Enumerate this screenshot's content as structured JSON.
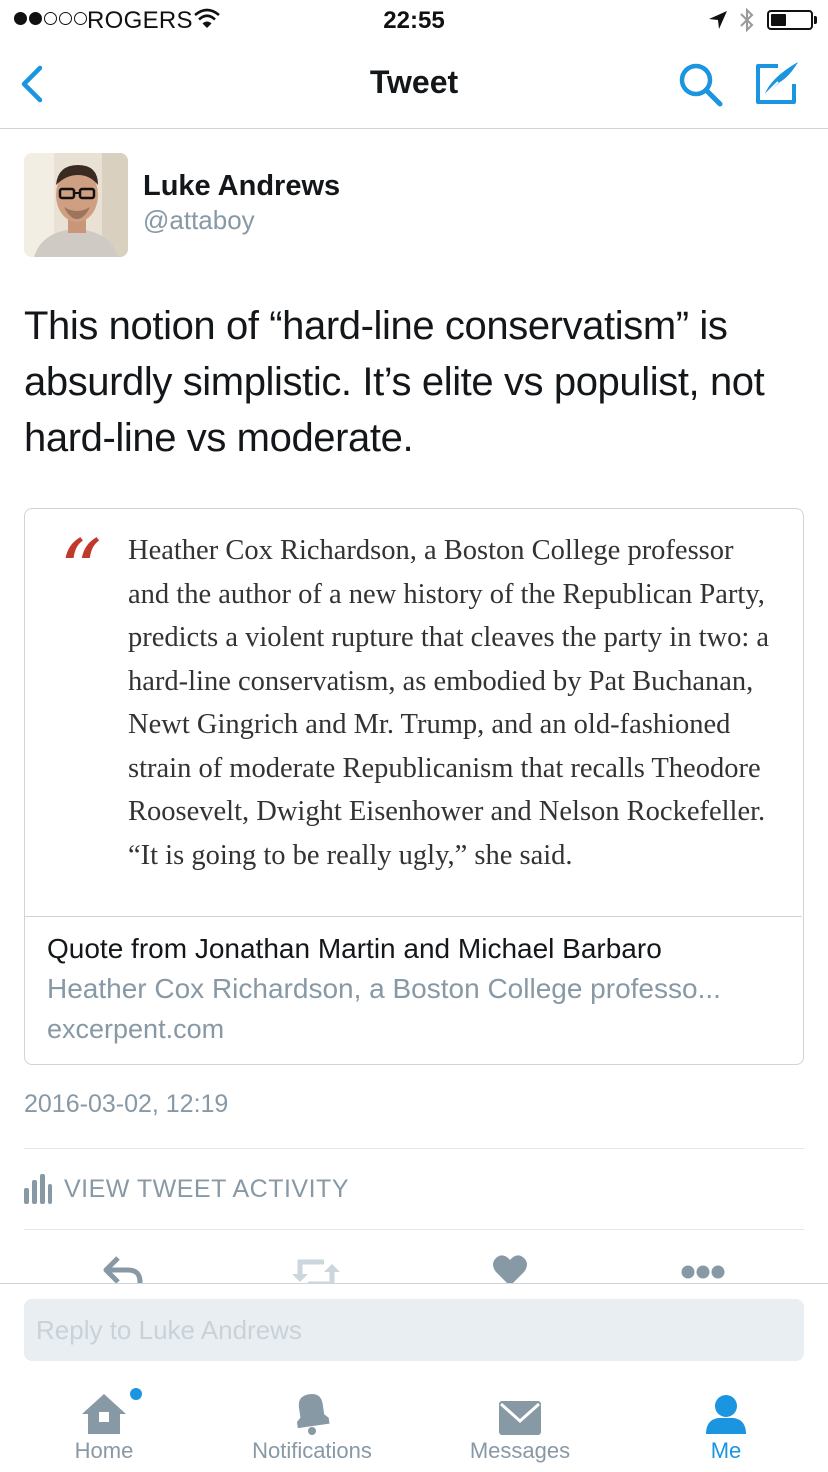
{
  "status_bar": {
    "carrier": "ROGERS",
    "time": "22:55",
    "battery_level": 0.45
  },
  "nav": {
    "title": "Tweet",
    "icons": [
      "back-icon",
      "search-icon",
      "compose-icon"
    ]
  },
  "tweet": {
    "author_name": "Luke Andrews",
    "author_handle": "@attaboy",
    "text": "This notion of “hard-line conservatism” is absurdly simplistic. It’s elite vs populist, not hard-line vs moderate.",
    "timestamp": "2016-03-02, 12:19"
  },
  "card": {
    "quote_mark": "“",
    "quote_lines": [
      "Heather Cox Richardson, a Boston College professor",
      "and the author of a new history of the Republican Party,",
      "predicts a violent rupture that cleaves the party in two: a",
      "hard-line conservatism, as embodied by Pat Buchanan,",
      "Newt Gingrich and Mr. Trump, and an old-fashioned",
      "strain of moderate Republicanism that recalls Theodore",
      "Roosevelt, Dwight Eisenhower and Nelson Rockefeller.",
      "“It is going to be really ugly,” she said."
    ],
    "title": "Quote from Jonathan Martin and Michael Barbaro",
    "description": "Heather Cox Richardson, a Boston College professo...",
    "domain": "excerpent.com",
    "quote_color": "#c0392b"
  },
  "activity": {
    "label": "VIEW TWEET ACTIVITY"
  },
  "actions": [
    "reply-icon",
    "retweet-icon",
    "like-icon",
    "more-icon"
  ],
  "reply": {
    "placeholder": "Reply to Luke Andrews"
  },
  "tabs": [
    {
      "label": "Home",
      "icon": "home-icon",
      "active": false,
      "has_badge": true
    },
    {
      "label": "Notifications",
      "icon": "bell-icon",
      "active": false,
      "has_badge": false
    },
    {
      "label": "Messages",
      "icon": "envelope-icon",
      "active": false,
      "has_badge": false
    },
    {
      "label": "Me",
      "icon": "person-icon",
      "active": true,
      "has_badge": false
    }
  ],
  "colors": {
    "accent": "#1b95e0",
    "muted": "#8899a6",
    "text": "#14171a"
  }
}
